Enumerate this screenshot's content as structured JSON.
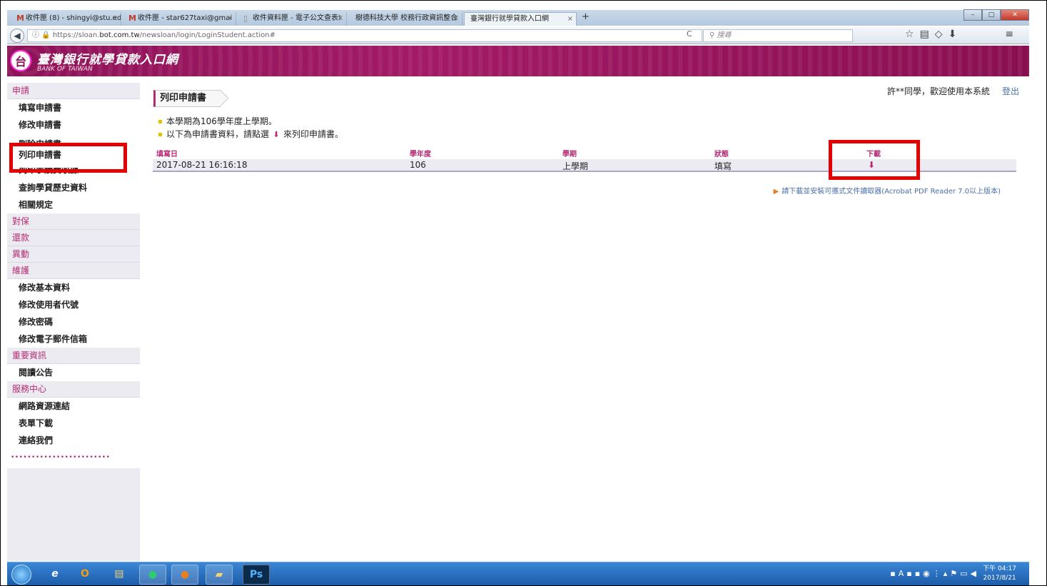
{
  "browser": {
    "tabs": [
      {
        "label": "收件匣 (8) - shingyi@stu.ed"
      },
      {
        "label": "收件匣 - star627taxi@gmai"
      },
      {
        "label": "收件資料匣 - 電子公文查表!"
      },
      {
        "label": "樹德科技大學 校務行政資訊整合"
      },
      {
        "label": "臺灣銀行就學貸款入口網"
      }
    ],
    "new_tab": "+",
    "url_prefix": "https://sloan.",
    "url_domain": "bot.com.tw",
    "url_path": "/newsloan/login/LoginStudent.action#",
    "search_placeholder": "搜尋"
  },
  "site": {
    "title": "臺灣銀行就學貸款入口網",
    "subtitle": "BANK OF TAIWAN"
  },
  "sidebar": {
    "groups": [
      {
        "label": "申請",
        "items": [
          "填寫申請書",
          "修改申請書",
          "刪除申請書",
          "列印申請書",
          "列印手續費收據",
          "查詢學貸歷史資料",
          "相關規定"
        ]
      },
      {
        "label": "對保",
        "items": []
      },
      {
        "label": "還款",
        "items": []
      },
      {
        "label": "異動",
        "items": []
      },
      {
        "label": "維護",
        "items": [
          "修改基本資料",
          "修改使用者代號",
          "修改密碼",
          "修改電子郵件信箱"
        ]
      },
      {
        "label": "重要資訊",
        "items": [
          "閱讀公告"
        ]
      },
      {
        "label": "服務中心",
        "items": [
          "網路資源連結",
          "表單下載",
          "連絡我們"
        ]
      }
    ],
    "dots": "••••••••••••••••••••••••"
  },
  "main": {
    "breadcrumb": "列印申請書",
    "greeting": "許**同學，歡迎使用本系統",
    "logout": "登出",
    "note1": "本學期為106學年度上學期。",
    "note2_a": "以下為申請書資料，請點選",
    "note2_b": "來列印申請書。",
    "table": {
      "headers": [
        "填寫日",
        "學年度",
        "學期",
        "狀態",
        "下載"
      ],
      "rows": [
        {
          "date": "2017-08-21 16:16:18",
          "year": "106",
          "term": "上學期",
          "status": "填寫"
        }
      ]
    },
    "acrobat_note": "請下載並安裝可攜式文件讀取器(Acrobat PDF Reader 7.0以上版本)"
  },
  "taskbar": {
    "clock_time": "下午 04:17",
    "clock_date": "2017/8/21",
    "ps_label": "Ps"
  },
  "colors": {
    "brand": "#8e1258",
    "accent": "#b42b74",
    "highlight": "#e60000"
  }
}
